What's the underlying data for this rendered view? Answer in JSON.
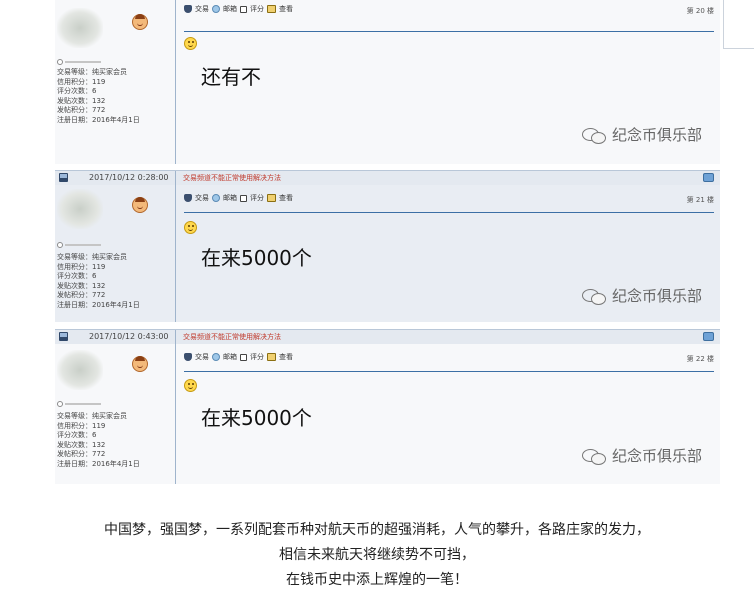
{
  "posts": [
    {
      "toolbar": {
        "trade": "交易",
        "mailbox": "邮箱",
        "rating": "评分",
        "view": "查看"
      },
      "floor": "第 20 楼",
      "user": {
        "level": "交易等级：纯买家会员",
        "credit": "信用积分：119",
        "rating_count": "评分次数：6",
        "post_count": "发贴次数：132",
        "post_points": "发帖积分：772",
        "register_date": "注册日期：2016年4月1日"
      },
      "content": "还有不",
      "watermark": "纪念币俱乐部"
    },
    {
      "meta": {
        "datetime": "2017/10/12 0:28:00",
        "notice": "交易频道不能正常使用解决方法"
      },
      "toolbar": {
        "trade": "交易",
        "mailbox": "邮箱",
        "rating": "评分",
        "view": "查看"
      },
      "floor": "第 21 楼",
      "user": {
        "level": "交易等级：纯买家会员",
        "credit": "信用积分：119",
        "rating_count": "评分次数：6",
        "post_count": "发贴次数：132",
        "post_points": "发帖积分：772",
        "register_date": "注册日期：2016年4月1日"
      },
      "content": "在来5000个",
      "watermark": "纪念币俱乐部"
    },
    {
      "meta": {
        "datetime": "2017/10/12 0:43:00",
        "notice": "交易频道不能正常使用解决方法"
      },
      "toolbar": {
        "trade": "交易",
        "mailbox": "邮箱",
        "rating": "评分",
        "view": "查看"
      },
      "floor": "第 22 楼",
      "user": {
        "level": "交易等级：纯买家会员",
        "credit": "信用积分：119",
        "rating_count": "评分次数：6",
        "post_count": "发贴次数：132",
        "post_points": "发帖积分：772",
        "register_date": "注册日期：2016年4月1日"
      },
      "content": "在来5000个",
      "watermark": "纪念币俱乐部"
    }
  ],
  "caption": {
    "line1": "中国梦，强国梦，一系列配套币种对航天币的超强消耗，人气的攀升，各路庄家的发力，",
    "line2": "相信未来航天将继续势不可挡，",
    "line3": "在钱币史中添上辉煌的一笔！"
  }
}
